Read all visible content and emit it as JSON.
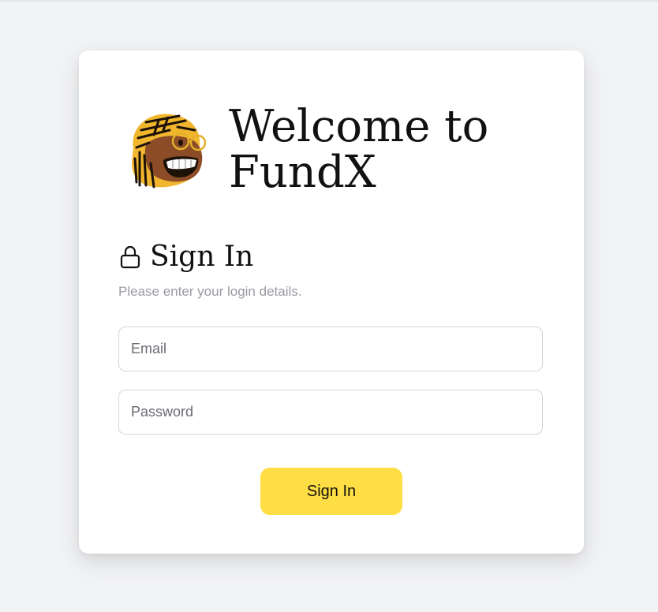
{
  "header": {
    "welcome_text": "Welcome to FundX"
  },
  "signin": {
    "title": "Sign In",
    "subtitle": "Please enter your login details.",
    "lock_icon": "lock-icon"
  },
  "form": {
    "email_placeholder": "Email",
    "email_value": "",
    "password_placeholder": "Password",
    "password_value": "",
    "submit_label": "Sign In"
  },
  "colors": {
    "page_background": "#f2f3f5",
    "card_background": "#ffffff",
    "accent_button": "#ffdd44",
    "subtitle_text": "#9a9aa2"
  }
}
